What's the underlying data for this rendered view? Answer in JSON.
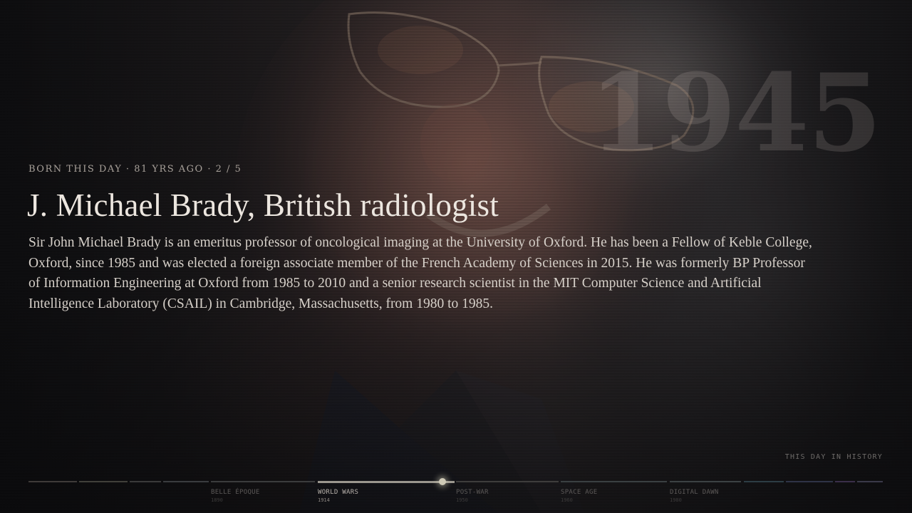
{
  "header": {
    "year": "1945",
    "kicker": "BORN THIS DAY · 81 YRS AGO · 2 / 5"
  },
  "entry": {
    "title": "J. Michael Brady, British radiologist",
    "description": "Sir John Michael Brady is an emeritus professor of oncological imaging at the University of Oxford. He has been a Fellow of Keble College, Oxford, since 1985 and was elected a foreign associate member of the French Academy of Sciences in 2015. He was formerly BP Professor of Information Engineering at Oxford from 1985 to 2010 and a senior research scientist in the MIT Computer Science and Artificial Intelligence Laboratory (CSAIL) in Cambridge, Massachusetts, from 1980 to 1985."
  },
  "brand": "THIS DAY IN HISTORY",
  "timeline": {
    "eras": [
      {
        "label": "BELLE ÉPOQUE",
        "year": "1890"
      },
      {
        "label": "WORLD WARS",
        "year": "1914",
        "active": true
      },
      {
        "label": "POST-WAR",
        "year": "1950"
      },
      {
        "label": "SPACE AGE",
        "year": "1960"
      },
      {
        "label": "DIGITAL DAWN",
        "year": "1980"
      }
    ],
    "segment_colors": [
      "#3f3b39",
      "#41403a",
      "#3a3a3a",
      "#3a3c3f",
      "#3b3c3d",
      "#3d3e3f",
      "#3e3d3c",
      "#3a4042",
      "#3c4244",
      "#2d3d45",
      "#2f3347",
      "#3a2f4a",
      "#3a3949"
    ],
    "current_year": "1945"
  }
}
